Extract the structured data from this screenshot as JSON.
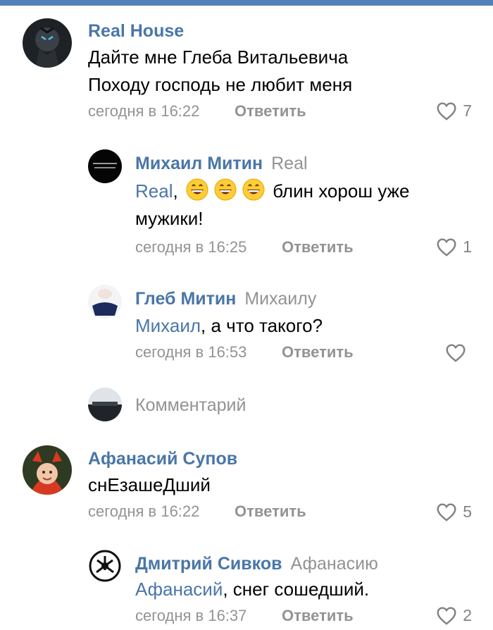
{
  "comments": [
    {
      "author": "Real House",
      "reply_to": "",
      "lines": [
        "Дайте мне Глеба Витальевича",
        "Походу господь не любит меня"
      ],
      "time": "сегодня в 16:22",
      "reply_label": "Ответить",
      "likes": "7"
    },
    {
      "author": "Михаил Митин",
      "reply_to": "Real",
      "mention": "Real",
      "after_mention": ",",
      "line1_rest": "блин хорош уже",
      "line2": "мужики!",
      "time": "сегодня в 16:25",
      "reply_label": "Ответить",
      "likes": "1"
    },
    {
      "author": "Глеб Митин",
      "reply_to": "Михаилу",
      "mention": "Михаил",
      "rest": ", а что такого?",
      "time": "сегодня в 16:53",
      "reply_label": "Ответить",
      "likes": ""
    },
    {
      "author": "Афанасий Супов",
      "reply_to": "",
      "lines": [
        "снЕзашеДший"
      ],
      "time": "сегодня в 16:22",
      "reply_label": "Ответить",
      "likes": "5"
    },
    {
      "author": "Дмитрий Сивков",
      "reply_to": "Афанасию",
      "mention": "Афанасий",
      "rest": ", снег сошедший.",
      "time": "сегодня в 16:37",
      "reply_label": "Ответить",
      "likes": "2"
    }
  ],
  "composer": {
    "placeholder": "Комментарий"
  },
  "colors": {
    "accent": "#4a76a8",
    "topbar": "#5181b8",
    "muted": "#939393"
  },
  "icons": [
    "heart-icon",
    "grinning-emoji",
    "yamaha-logo"
  ]
}
